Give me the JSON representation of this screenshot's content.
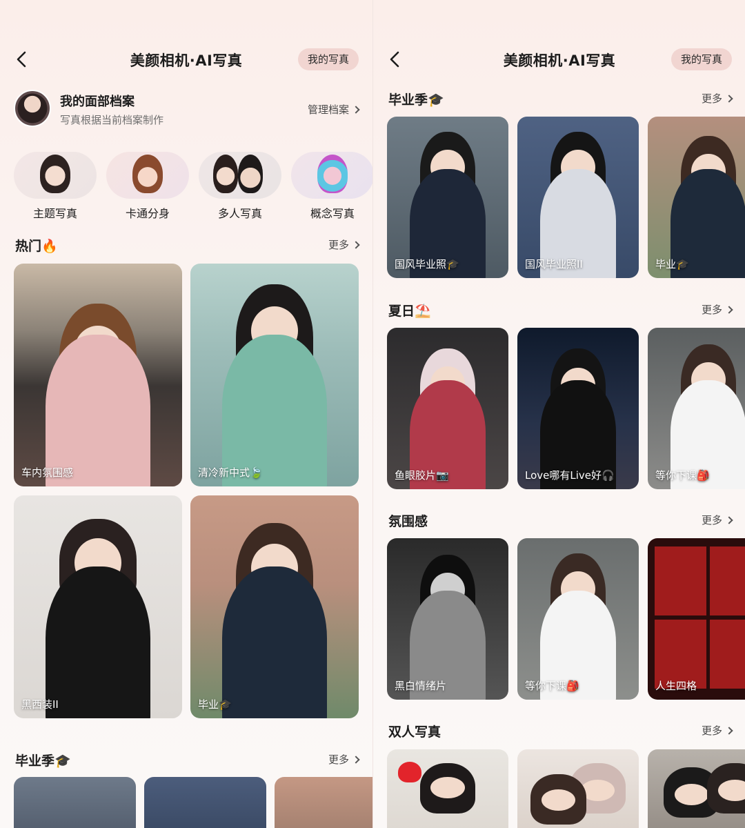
{
  "left": {
    "nav": {
      "title": "美颜相机·AI写真",
      "pill": "我的写真"
    },
    "profile": {
      "name": "我的面部档案",
      "subtitle": "写真根据当前档案制作",
      "manage": "管理档案"
    },
    "categories": [
      {
        "label": "主题写真"
      },
      {
        "label": "卡通分身"
      },
      {
        "label": "多人写真"
      },
      {
        "label": "概念写真"
      }
    ],
    "hot": {
      "title": "热门🔥",
      "more": "更多"
    },
    "hot_cards": [
      {
        "caption": "车内氛围感"
      },
      {
        "caption": "清冷新中式🍃"
      },
      {
        "caption": "黑西装II"
      },
      {
        "caption": "毕业🎓"
      }
    ],
    "grad": {
      "title": "毕业季🎓",
      "more": "更多"
    }
  },
  "right": {
    "nav": {
      "title": "美颜相机·AI写真",
      "pill": "我的写真"
    },
    "sections": [
      {
        "title": "毕业季🎓",
        "more": "更多",
        "cards": [
          "国风毕业照🎓",
          "国风毕业照II",
          "毕业🎓"
        ]
      },
      {
        "title": "夏日⛱️",
        "more": "更多",
        "cards": [
          "鱼眼胶片📷",
          "Love哪有Live好🎧",
          "等你下课🎒"
        ]
      },
      {
        "title": "氛围感",
        "more": "更多",
        "cards": [
          "黑白情绪片",
          "等你下课🎒",
          "人生四格"
        ]
      },
      {
        "title": "双人写真",
        "more": "更多",
        "cards": [
          "",
          "",
          ""
        ]
      }
    ]
  },
  "colors": {
    "pill_bg": "#f1d5d1",
    "background": "#faf3f1"
  }
}
